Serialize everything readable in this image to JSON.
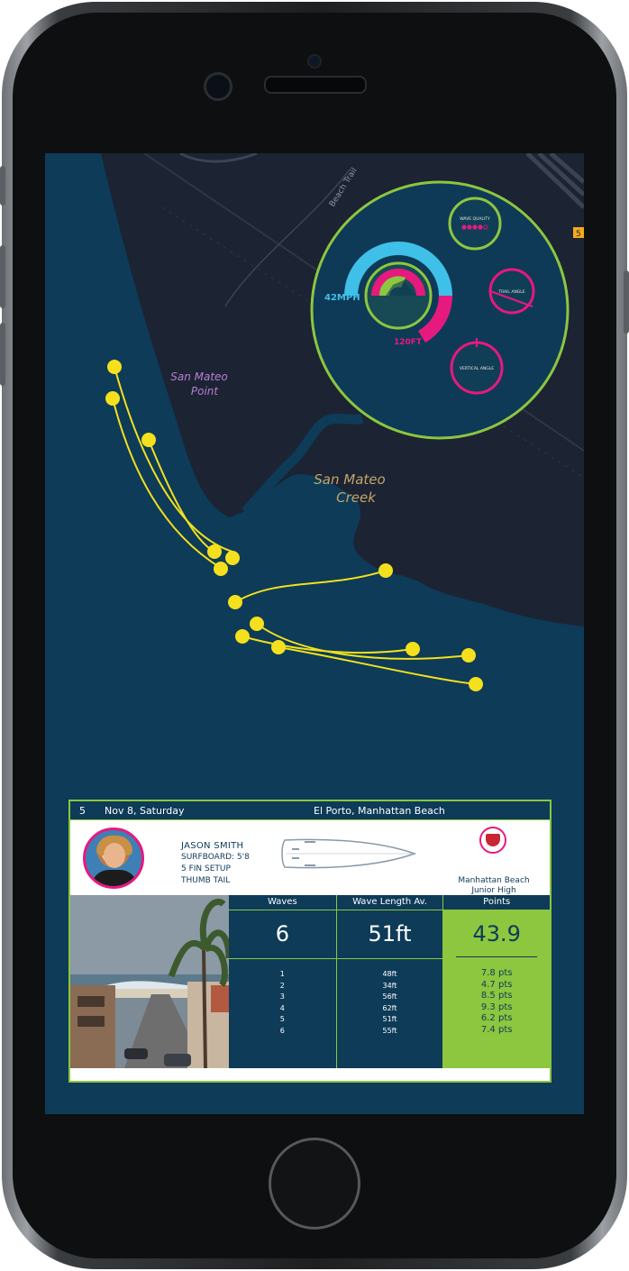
{
  "map": {
    "labels": {
      "trail": "Beach Trail",
      "point": [
        "San Mateo",
        "Point"
      ],
      "creek": [
        "San Mateo",
        "Creek"
      ],
      "road_shield": "5"
    }
  },
  "gauge": {
    "speed": "42MPH",
    "height": "120FT",
    "wave_quality": "WAVE QUALITY",
    "wave_quality_dots": 5,
    "wave_quality_filled": 4,
    "trail_angle": "TRAIL ANGLE",
    "vertical_angle": "VERTICAL ANGLE"
  },
  "session": {
    "number": "5",
    "date": "Nov 8, Saturday",
    "location": "El Porto, Manhattan Beach"
  },
  "surfer": {
    "name": "JASON SMITH",
    "surfboard": "SURFBOARD: 5'8",
    "fin_setup": "5 FIN SETUP",
    "tail": "THUMB TAIL"
  },
  "school": {
    "line1": "Manhattan Beach",
    "line2": "Junior High"
  },
  "stats": {
    "waves_header": "Waves",
    "waves_total": "6",
    "length_header": "Wave Length Av.",
    "length_avg": "51ft",
    "points_header": "Points",
    "points_total": "43.9",
    "rows": [
      {
        "wave": "1",
        "length": "48ft",
        "points": "7.8 pts"
      },
      {
        "wave": "2",
        "length": "34ft",
        "points": "4.7 pts"
      },
      {
        "wave": "3",
        "length": "56ft",
        "points": "8.5 pts"
      },
      {
        "wave": "4",
        "length": "62ft",
        "points": "9.3 pts"
      },
      {
        "wave": "5",
        "length": "51ft",
        "points": "6.2 pts"
      },
      {
        "wave": "6",
        "length": "55ft",
        "points": "7.4 pts"
      }
    ]
  },
  "colors": {
    "ocean": "#0d3b58",
    "land": "#1c2333",
    "track": "#f4e01c",
    "accent_green": "#8dc63f",
    "accent_pink": "#e6197f",
    "accent_cyan": "#3fc0e8"
  }
}
